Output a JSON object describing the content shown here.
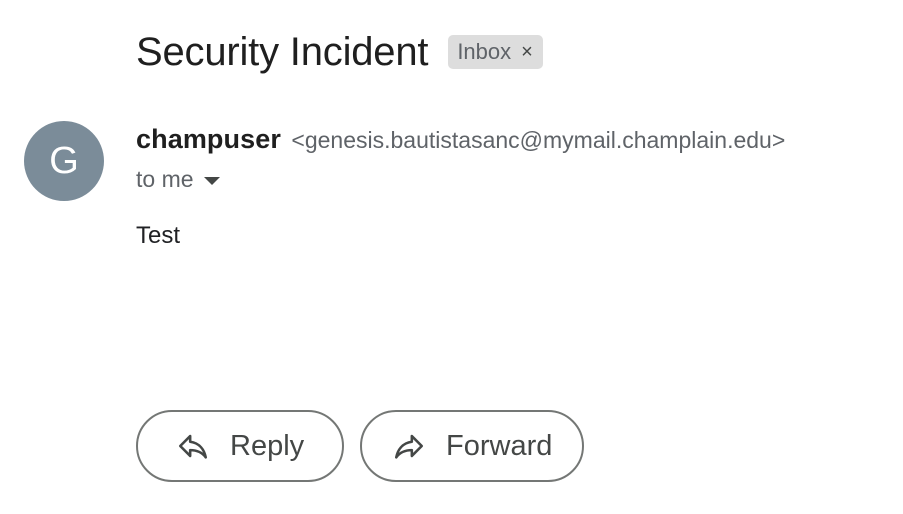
{
  "message": {
    "subject": "Security Incident",
    "label_chip": {
      "text": "Inbox",
      "remove_glyph": "×"
    },
    "sender": {
      "avatar_letter": "G",
      "avatar_color": "#7b8c99",
      "name": "champuser",
      "email": "<genesis.bautistasanc@mymail.champlain.edu>"
    },
    "recipient_text": "to me",
    "body": "Test"
  },
  "actions": {
    "reply_label": "Reply",
    "forward_label": "Forward",
    "reply_icon": "reply-arrow-icon",
    "forward_icon": "forward-arrow-icon"
  }
}
